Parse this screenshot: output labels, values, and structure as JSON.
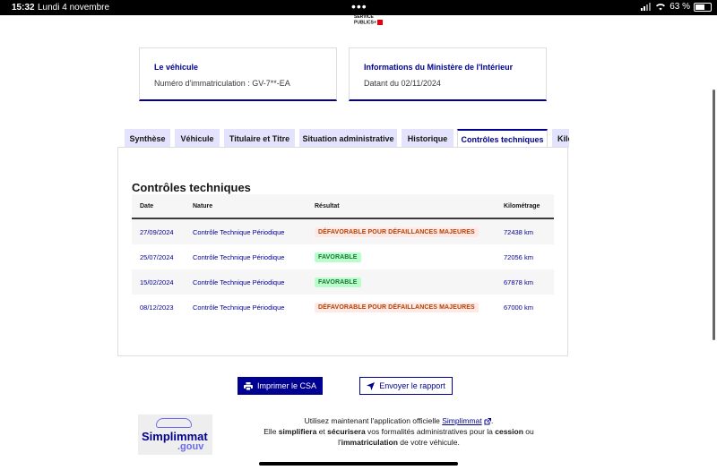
{
  "status_bar": {
    "time": "15:32",
    "date": "Lundi 4 novembre",
    "battery": "63 %",
    "battery_level": 0.63
  },
  "logo": {
    "line1": "SERVICE",
    "line2": "PUBLICS+"
  },
  "vehicle_card": {
    "title": "Le véhicule",
    "value": "Numéro d'immatriculation : GV-7**-EA"
  },
  "ministry_card": {
    "title": "Informations du Ministère de l'Intérieur",
    "value": "Datant du 02/11/2024"
  },
  "tabs": [
    {
      "label": "Synthèse",
      "active": false
    },
    {
      "label": "Véhicule",
      "active": false
    },
    {
      "label": "Titulaire et Titre",
      "active": false
    },
    {
      "label": "Situation administrative",
      "active": false
    },
    {
      "label": "Historique",
      "active": false
    },
    {
      "label": "Contrôles techniques",
      "active": true
    },
    {
      "label": "Kilo",
      "active": false
    }
  ],
  "section": {
    "title": "Contrôles techniques",
    "columns": [
      "Date",
      "Nature",
      "Résultat",
      "Kilométrage"
    ],
    "rows": [
      {
        "date": "27/09/2024",
        "nature": "Contrôle Technique Périodique",
        "result": "DÉFAVORABLE POUR DÉFAILLANCES MAJEURES",
        "status": "bad",
        "km": "72438 km"
      },
      {
        "date": "25/07/2024",
        "nature": "Contrôle Technique Périodique",
        "result": "FAVORABLE",
        "status": "good",
        "km": "72056 km"
      },
      {
        "date": "15/02/2024",
        "nature": "Contrôle Technique Périodique",
        "result": "FAVORABLE",
        "status": "good",
        "km": "67878 km"
      },
      {
        "date": "08/12/2023",
        "nature": "Contrôle Technique Périodique",
        "result": "DÉFAVORABLE POUR DÉFAILLANCES MAJEURES",
        "status": "bad",
        "km": "67000 km"
      }
    ]
  },
  "actions": {
    "print_label": "Imprimer le CSA",
    "send_label": "Envoyer le rapport"
  },
  "app_logo": {
    "name": "Simplimmat",
    "suffix": ".gouv"
  },
  "promo": {
    "p1": "Utilisez maintenant l'application officielle ",
    "link": "Simplimmat",
    "p2": ".",
    "l2a": "Elle ",
    "l2b": "simplifiera",
    "l2c": " et ",
    "l2d": "sécurisera",
    "l2e": " vos formalités administratives pour la ",
    "l2f": "cession",
    "l2g": " ou",
    "l3a": "l'",
    "l3b": "immatriculation",
    "l3c": " de votre véhicule."
  },
  "colors": {
    "primary": "#000091",
    "tab_bg": "#e3e3fd",
    "bad_bg": "#ffe9e6",
    "bad_fg": "#b34000",
    "good_bg": "#b8fec9",
    "good_fg": "#18753c"
  }
}
